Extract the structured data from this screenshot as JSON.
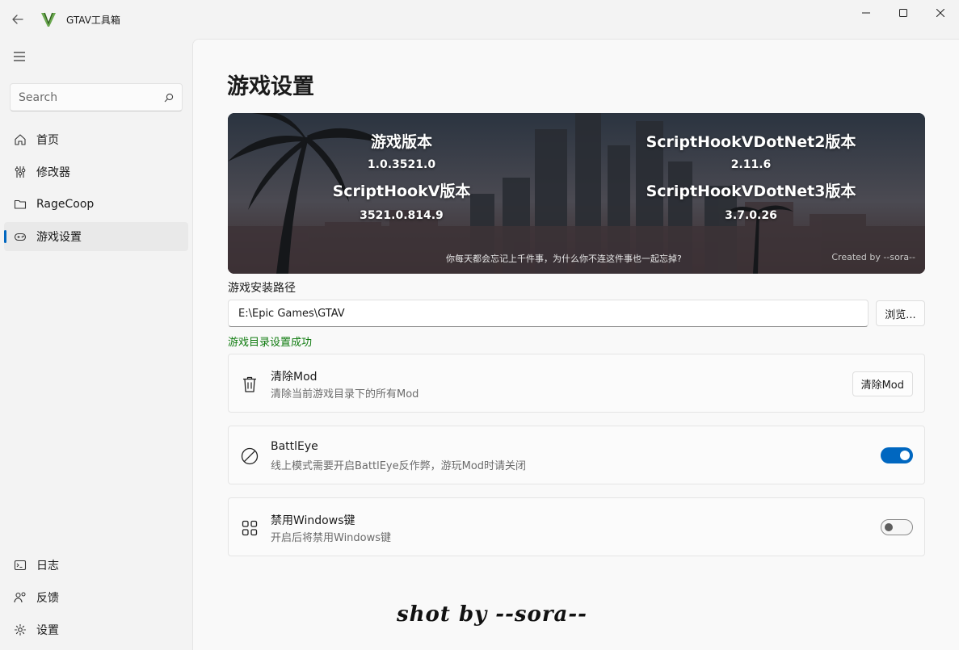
{
  "app": {
    "title": "GTAV工具箱"
  },
  "sidebar": {
    "search_placeholder": "Search",
    "items": [
      {
        "label": "首页",
        "icon": "home-icon"
      },
      {
        "label": "修改器",
        "icon": "sliders-icon"
      },
      {
        "label": "RageCoop",
        "icon": "folder-icon"
      },
      {
        "label": "游戏设置",
        "icon": "gamepad-icon",
        "active": true
      }
    ],
    "footer_items": [
      {
        "label": "日志",
        "icon": "console-icon"
      },
      {
        "label": "反馈",
        "icon": "feedback-icon"
      },
      {
        "label": "设置",
        "icon": "gear-icon"
      }
    ]
  },
  "page": {
    "title": "游戏设置",
    "banner": {
      "game_version_label": "游戏版本",
      "game_version": "1.0.3521.0",
      "shv_label": "ScriptHookV版本",
      "shv_version": "3521.0.814.9",
      "shvdn2_label": "ScriptHookVDotNet2版本",
      "shvdn2_version": "2.11.6",
      "shvdn3_label": "ScriptHookVDotNet3版本",
      "shvdn3_version": "3.7.0.26",
      "quote": "你每天都会忘记上千件事，为什么你不连这件事也一起忘掉?",
      "credit": "Created by --sora--"
    },
    "install_path_label": "游戏安装路径",
    "install_path_value": "E:\\Epic Games\\GTAV",
    "browse_label": "浏览...",
    "success_message": "游戏目录设置成功",
    "cards": {
      "clear_mod": {
        "title": "清除Mod",
        "desc": "清除当前游戏目录下的所有Mod",
        "button": "清除Mod"
      },
      "battleye": {
        "title": "BattlEye",
        "desc": "线上模式需要开启BattlEye反作弊，游玩Mod时请关闭",
        "enabled": true
      },
      "windows_key": {
        "title": "禁用Windows键",
        "desc": "开启后将禁用Windows键",
        "enabled": false
      }
    },
    "signature": "shot by --sora--"
  },
  "colors": {
    "accent": "#0067c0",
    "success": "#0f7b0f"
  }
}
